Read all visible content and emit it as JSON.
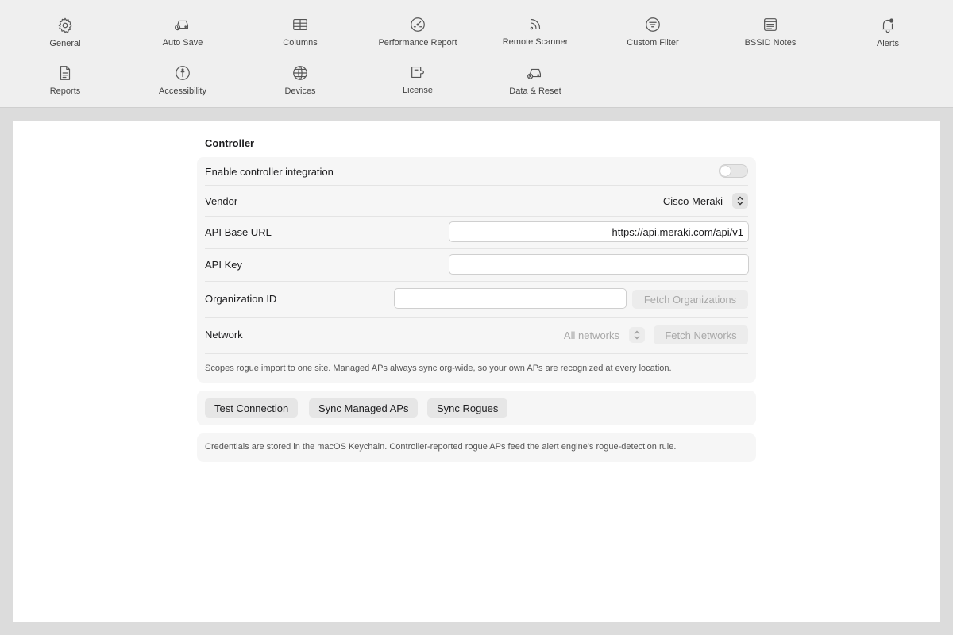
{
  "toolbar": {
    "items": [
      {
        "label": "General",
        "icon": "gear-icon"
      },
      {
        "label": "Auto Save",
        "icon": "auto-save-icon"
      },
      {
        "label": "Columns",
        "icon": "table-icon"
      },
      {
        "label": "Performance Report",
        "icon": "gauge-icon"
      },
      {
        "label": "Remote Scanner",
        "icon": "feed-icon"
      },
      {
        "label": "Custom Filter",
        "icon": "filter-icon"
      },
      {
        "label": "BSSID Notes",
        "icon": "notes-icon"
      },
      {
        "label": "Alerts",
        "icon": "bell-icon"
      },
      {
        "label": "Reports",
        "icon": "document-icon"
      },
      {
        "label": "Accessibility",
        "icon": "accessibility-icon"
      },
      {
        "label": "Devices",
        "icon": "globe-icon"
      },
      {
        "label": "License",
        "icon": "license-icon"
      },
      {
        "label": "Data & Reset",
        "icon": "reset-drive-icon"
      }
    ]
  },
  "section": {
    "title": "Controller",
    "enable_label": "Enable controller integration",
    "enable_on": false,
    "vendor_label": "Vendor",
    "vendor_value": "Cisco Meraki",
    "api_url_label": "API Base URL",
    "api_url_value": "https://api.meraki.com/api/v1",
    "api_key_label": "API Key",
    "api_key_value": "",
    "org_label": "Organization ID",
    "org_value": "",
    "fetch_orgs": "Fetch Organizations",
    "network_label": "Network",
    "network_value": "All networks",
    "fetch_networks": "Fetch Networks",
    "network_hint": "Scopes rogue import to one site. Managed APs always sync org-wide, so your own APs are recognized at every location."
  },
  "actions": {
    "test": "Test Connection",
    "sync_managed": "Sync Managed APs",
    "sync_rogues": "Sync Rogues"
  },
  "note": "Credentials are stored in the macOS Keychain. Controller-reported rogue APs feed the alert engine's rogue-detection rule."
}
